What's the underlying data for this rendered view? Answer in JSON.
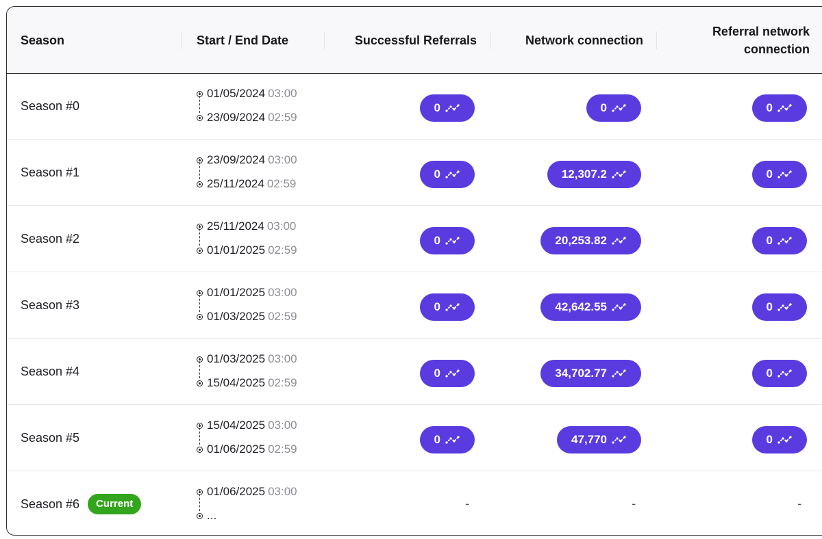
{
  "headers": {
    "season": "Season",
    "dates": "Start / End Date",
    "referrals": "Successful Referrals",
    "network": "Network connection",
    "ref_network_1": "Referral network",
    "ref_network_2": "connection"
  },
  "icons": {
    "pill": "trend-line-icon",
    "date": "timeline-dot-icon"
  },
  "colors": {
    "pill": "#5a3be0",
    "current_badge": "#33a51c"
  },
  "rows": [
    {
      "season": "Season #0",
      "start_date": "01/05/2024",
      "start_time": "03:00",
      "end_date": "23/09/2024",
      "end_time": "02:59",
      "referrals": "0",
      "network": "0",
      "ref_network": "0"
    },
    {
      "season": "Season #1",
      "start_date": "23/09/2024",
      "start_time": "03:00",
      "end_date": "25/11/2024",
      "end_time": "02:59",
      "referrals": "0",
      "network": "12,307.2",
      "ref_network": "0"
    },
    {
      "season": "Season #2",
      "start_date": "25/11/2024",
      "start_time": "03:00",
      "end_date": "01/01/2025",
      "end_time": "02:59",
      "referrals": "0",
      "network": "20,253.82",
      "ref_network": "0"
    },
    {
      "season": "Season #3",
      "start_date": "01/01/2025",
      "start_time": "03:00",
      "end_date": "01/03/2025",
      "end_time": "02:59",
      "referrals": "0",
      "network": "42,642.55",
      "ref_network": "0"
    },
    {
      "season": "Season #4",
      "start_date": "01/03/2025",
      "start_time": "03:00",
      "end_date": "15/04/2025",
      "end_time": "02:59",
      "referrals": "0",
      "network": "34,702.77",
      "ref_network": "0"
    },
    {
      "season": "Season #5",
      "start_date": "15/04/2025",
      "start_time": "03:00",
      "end_date": "01/06/2025",
      "end_time": "02:59",
      "referrals": "0",
      "network": "47,770",
      "ref_network": "0"
    },
    {
      "season": "Season #6",
      "badge": "Current",
      "start_date": "01/06/2025",
      "start_time": "03:00",
      "end_date": "...",
      "end_time": "",
      "referrals": "-",
      "network": "-",
      "ref_network": "-"
    }
  ]
}
